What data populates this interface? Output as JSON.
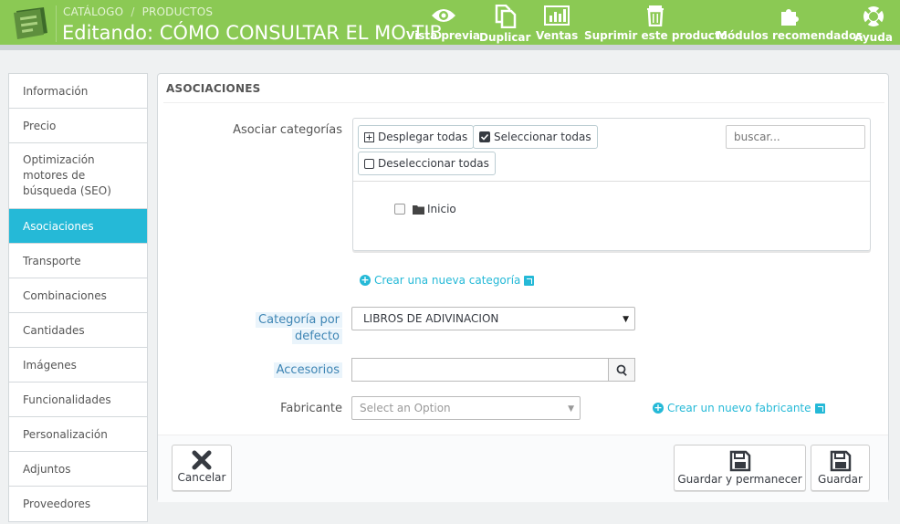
{
  "header": {
    "breadcrumb": [
      "CATÁLOGO",
      "PRODUCTOS"
    ],
    "breadcrumb_separator": "/",
    "title": "Editando: CÓMO CONSULTAR EL MO TIB",
    "toolbar": [
      {
        "label": "Vista previa",
        "icon": "eye-icon"
      },
      {
        "label": "Duplicar",
        "icon": "copy-icon"
      },
      {
        "label": "Ventas",
        "icon": "bar-chart-icon"
      },
      {
        "label": "Suprimir este producto",
        "icon": "trash-icon"
      },
      {
        "label": "Módulos recomendados",
        "icon": "puzzle-icon"
      },
      {
        "label": "Ayuda",
        "icon": "lifebuoy-icon"
      }
    ]
  },
  "tabs": [
    {
      "label": "Información"
    },
    {
      "label": "Precio"
    },
    {
      "label": "Optimización motores de búsqueda (SEO)"
    },
    {
      "label": "Asociaciones"
    },
    {
      "label": "Transporte"
    },
    {
      "label": "Combinaciones"
    },
    {
      "label": "Cantidades"
    },
    {
      "label": "Imágenes"
    },
    {
      "label": "Funcionalidades"
    },
    {
      "label": "Personalización"
    },
    {
      "label": "Adjuntos"
    },
    {
      "label": "Proveedores"
    }
  ],
  "active_tab": "Asociaciones",
  "panel": {
    "title": "ASOCIACIONES",
    "categories": {
      "label": "Asociar categorías",
      "expand_all": "Desplegar todas",
      "select_all": "Seleccionar todas",
      "deselect_all": "Deseleccionar todas",
      "search_placeholder": "buscar...",
      "root_node": "Inicio",
      "new_category_link": "Crear una nueva categoría"
    },
    "default_category": {
      "label_line1": "Categoría por",
      "label_line2": "defecto",
      "value": "LIBROS DE ADIVINACION"
    },
    "accessories": {
      "label": "Accesorios",
      "value": ""
    },
    "manufacturer": {
      "label": "Fabricante",
      "placeholder": "Select an Option",
      "new_link": "Crear un nuevo fabricante"
    },
    "footer": {
      "cancel": "Cancelar",
      "save_stay": "Guardar y permanecer",
      "save": "Guardar"
    }
  },
  "colors": {
    "header_green": "#8bc954",
    "accent_blue": "#25b9d7"
  }
}
